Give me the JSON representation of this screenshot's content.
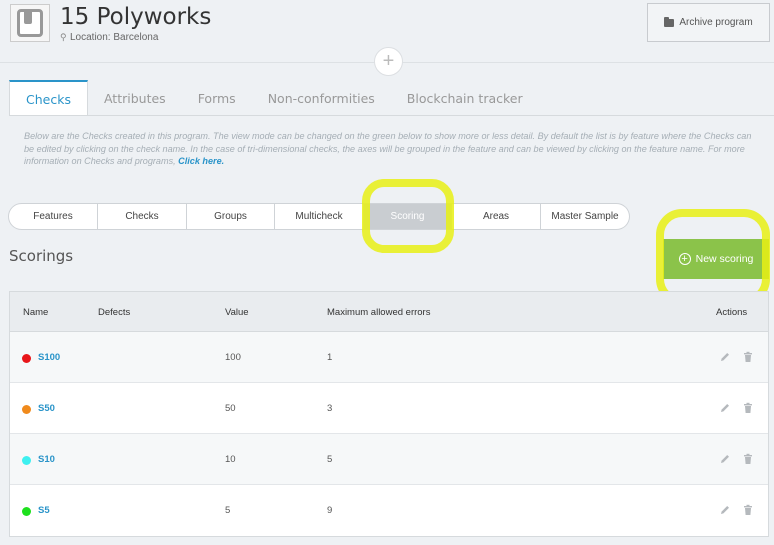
{
  "header": {
    "title": "15 Polyworks",
    "location": "Location: Barcelona",
    "archive_label": "Archive program",
    "add_symbol": "+"
  },
  "tabs": [
    {
      "label": "Checks",
      "active": true
    },
    {
      "label": "Attributes",
      "active": false
    },
    {
      "label": "Forms",
      "active": false
    },
    {
      "label": "Non-conformities",
      "active": false
    },
    {
      "label": "Blockchain tracker",
      "active": false
    }
  ],
  "info": {
    "text": "Below are the Checks created in this program. The view mode can be changed on the green below to show more or less detail. By default the list is by feature where the Checks can be edited by clicking on the check name. In the case of tri-dimensional checks, the axes will be grouped in the feature and can be viewed by clicking on the feature name. For more information on Checks and programs, ",
    "link": "Click here."
  },
  "view_modes": [
    {
      "label": "Features",
      "active": false
    },
    {
      "label": "Checks",
      "active": false
    },
    {
      "label": "Groups",
      "active": false
    },
    {
      "label": "Multicheck",
      "active": false
    },
    {
      "label": "Scoring",
      "active": true
    },
    {
      "label": "Areas",
      "active": false
    },
    {
      "label": "Master Sample",
      "active": false
    }
  ],
  "section": {
    "title": "Scorings",
    "new_button": "New scoring"
  },
  "table": {
    "headers": {
      "name": "Name",
      "defects": "Defects",
      "value": "Value",
      "max_errors": "Maximum allowed errors",
      "actions": "Actions"
    },
    "rows": [
      {
        "name": "S100",
        "color": "#e8161a",
        "defects": "",
        "value": "100",
        "max_errors": "1"
      },
      {
        "name": "S50",
        "color": "#f08a1c",
        "defects": "",
        "value": "50",
        "max_errors": "3"
      },
      {
        "name": "S10",
        "color": "#3ef0f0",
        "defects": "",
        "value": "10",
        "max_errors": "5"
      },
      {
        "name": "S5",
        "color": "#1ee01e",
        "defects": "",
        "value": "5",
        "max_errors": "9"
      }
    ]
  },
  "colors": {
    "accent": "#2a94c9",
    "new_button": "#8bc34a",
    "highlight": "#e8f014"
  }
}
